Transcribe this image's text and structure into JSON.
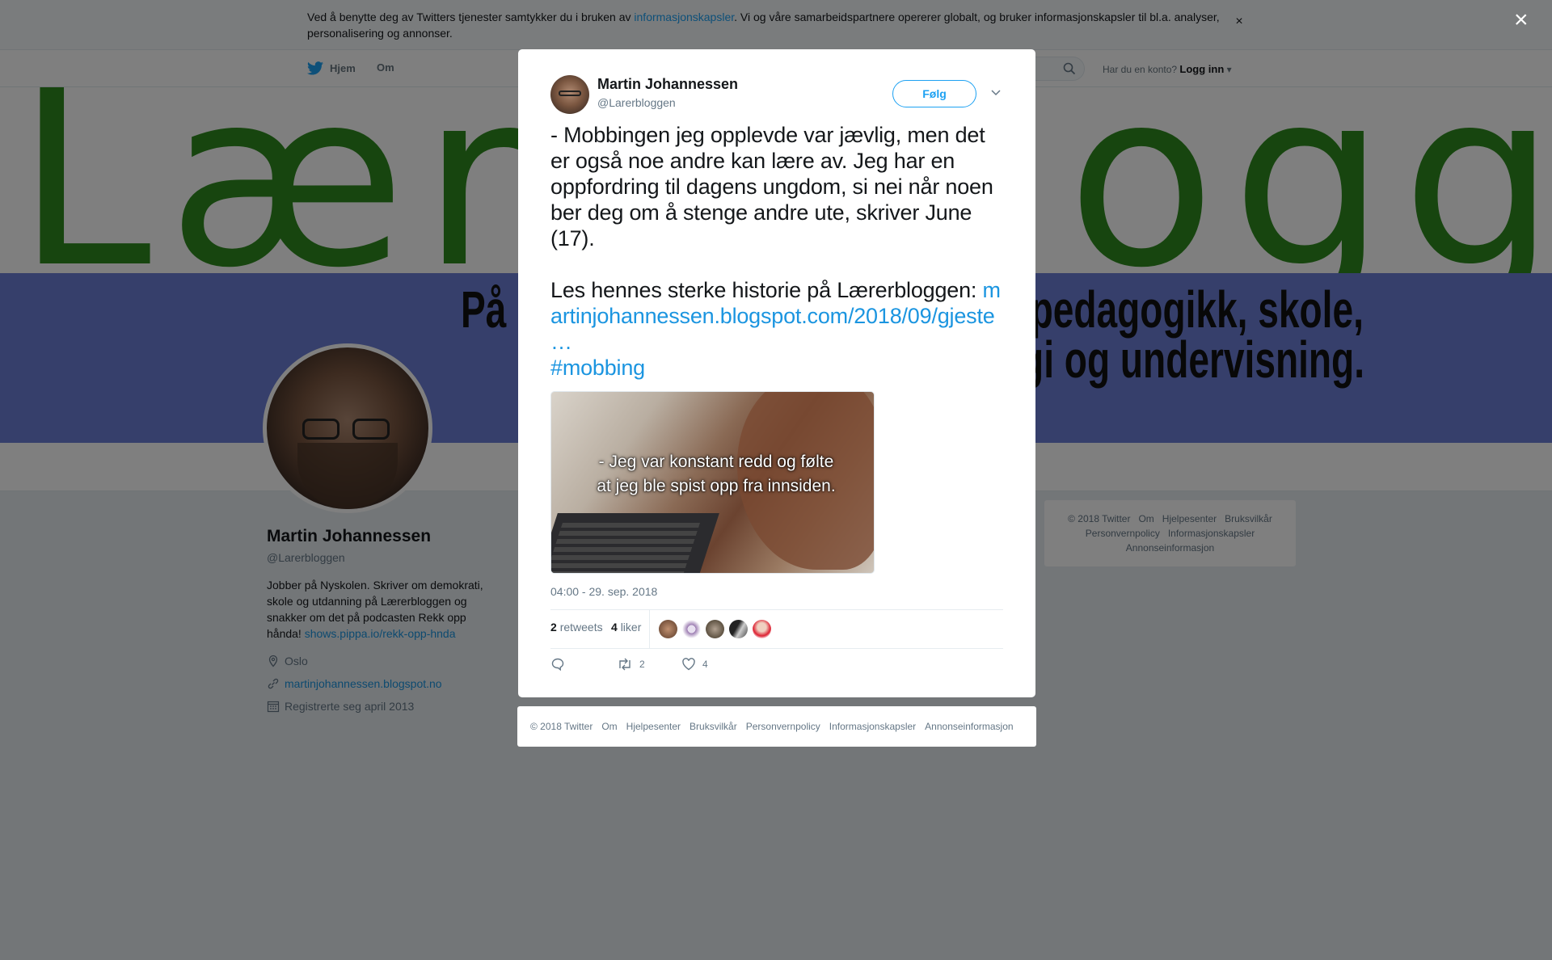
{
  "cookie_bar": {
    "text_before": "Ved å benytte deg av Twitters tjenester samtykker du i bruken av ",
    "link": "informasjonskapsler",
    "text_after": ". Vi og våre samarbeidspartnere opererer globalt, og bruker informasjonskapsler til bl.a. analyser, personalisering og annonser.",
    "close": "×"
  },
  "nav": {
    "home": "Hjem",
    "about": "Om",
    "have_account": "Har du en konto?",
    "login": "Logg inn"
  },
  "banner": {
    "tagline_line1": "På",
    "tagline_line2": "egg om pedagogikk, skole,",
    "tagline_line3": "teknologi og undervisning."
  },
  "profile": {
    "name": "Martin Johannessen",
    "handle": "@Larerbloggen",
    "bio": "Jobber på Nyskolen. Skriver om demokrati, skole og utdanning på Lærerbloggen og snakker om det på podcasten Rekk opp hånda! ",
    "bio_link": "shows.pippa.io/rekk-opp-hnda",
    "location": "Oslo",
    "website": "martinjohannessen.blogspot.no",
    "joined": "Registrerte seg april 2013"
  },
  "side_footer": {
    "items": [
      "© 2018 Twitter",
      "Om",
      "Hjelpesenter",
      "Bruksvilkår",
      "Personvernpolicy",
      "Informasjonskapsler",
      "Annonseinformasjon"
    ]
  },
  "overlay": {
    "close": "×"
  },
  "tweet": {
    "author_name": "Martin Johannessen",
    "author_handle": "@Larerbloggen",
    "follow_label": "Følg",
    "text_p1": "- Mobbingen jeg opplevde var jævlig, men det er også noe andre kan lære av. Jeg har en oppfordring til dagens ungdom, si nei når noen ber deg om å stenge andre ute, skriver June (17).",
    "text_p2": "Les hennes sterke historie på Lærerbloggen:",
    "link": "martinjohannessen.blogspot.com/2018/09/gjeste …",
    "hashtag": "#mobbing",
    "media_caption_line1": "- Jeg var konstant redd og følte",
    "media_caption_line2": "at jeg ble spist opp fra innsiden.",
    "timestamp": "04:00 - 29. sep. 2018",
    "retweets_count": "2",
    "retweets_label": "retweets",
    "likes_count": "4",
    "likes_label": "liker",
    "action_retweet_count": "2",
    "action_like_count": "4"
  },
  "modal_footer": {
    "items": [
      "© 2018 Twitter",
      "Om",
      "Hjelpesenter",
      "Bruksvilkår",
      "Personvernpolicy",
      "Informasjonskapsler",
      "Annonseinformasjon"
    ]
  },
  "colors": {
    "twitter_blue": "#1da1f2",
    "link_blue": "#1b95e0",
    "banner_green": "#2f8a1f",
    "banner_blue": "#6d7fd6"
  },
  "icons": {
    "twitter": "twitter-bird-icon",
    "search": "search-icon",
    "location": "location-pin-icon",
    "link": "link-icon",
    "calendar": "calendar-icon",
    "reply": "reply-icon",
    "retweet": "retweet-icon",
    "like": "heart-icon",
    "caret": "chevron-down-icon",
    "close": "close-icon"
  }
}
